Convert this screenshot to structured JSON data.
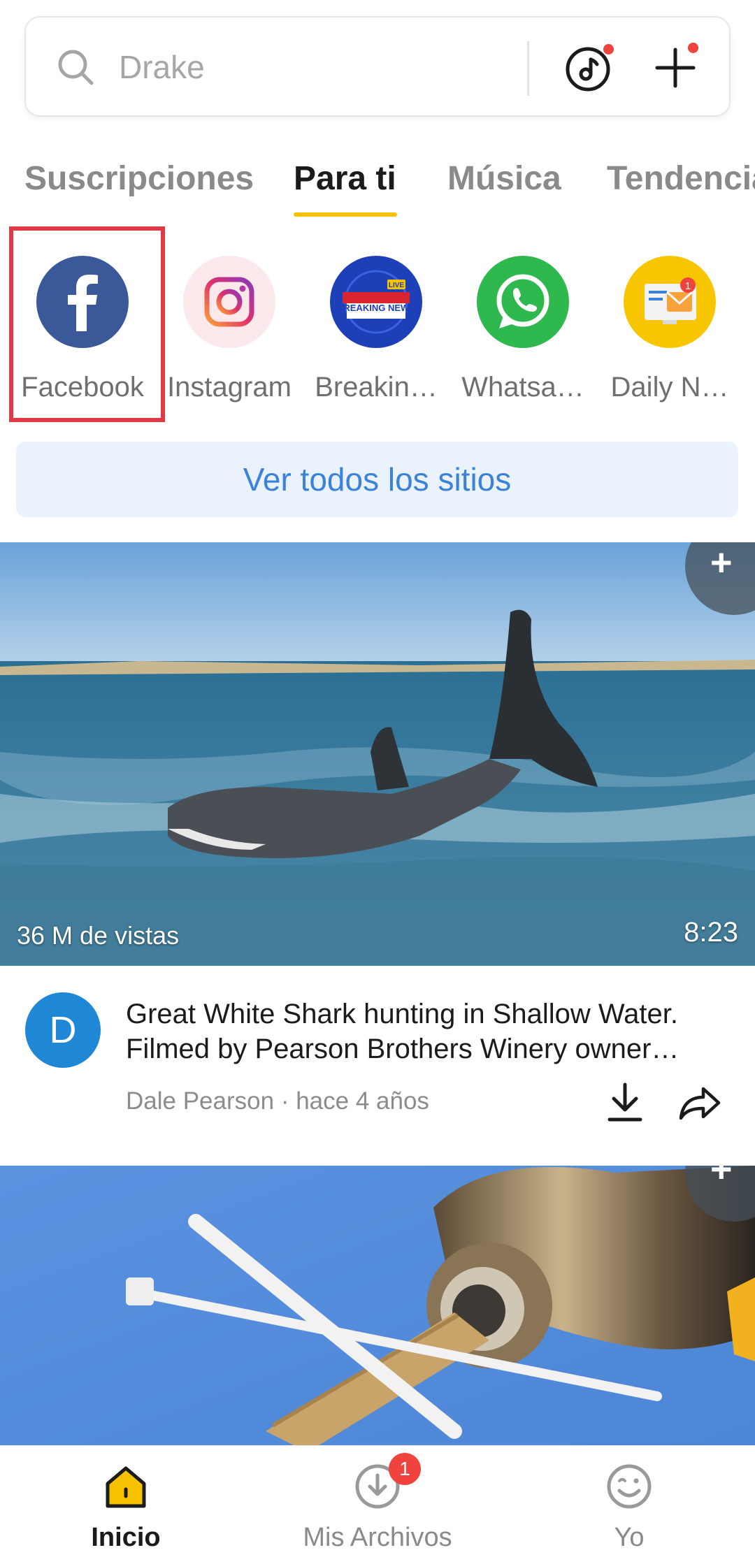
{
  "search": {
    "placeholder": "Drake"
  },
  "tabs": [
    {
      "label": "Suscripciones"
    },
    {
      "label": "Para ti",
      "active": true
    },
    {
      "label": "Música"
    },
    {
      "label": "Tendencia"
    }
  ],
  "sites": [
    {
      "label": "Facebook",
      "icon": "facebook-icon",
      "color": "#3b5998"
    },
    {
      "label": "Instagram",
      "icon": "instagram-icon",
      "color": "#fbe8ea"
    },
    {
      "label": "Breakin…",
      "icon": "breaking-news-icon",
      "color": "#1d3fb8",
      "logo_text": "BREAKING NEWS",
      "logo_badge": "LIVE"
    },
    {
      "label": "Whatsa…",
      "icon": "whatsapp-icon",
      "color": "#2fb84d"
    },
    {
      "label": "Daily N…",
      "icon": "daily-news-icon",
      "color": "#f7c600",
      "badge": "1"
    }
  ],
  "view_all_label": "Ver todos los sitios",
  "video1": {
    "views": "36 M de vistas",
    "duration": "8:23",
    "avatar_letter": "D",
    "title_line1": "Great White Shark hunting in Shallow Water.",
    "title_line2": "Filmed by Pearson Brothers Winery owner…",
    "channel": "Dale Pearson",
    "separator": "·",
    "age": "hace 4 años"
  },
  "bottom_nav": [
    {
      "label": "Inicio",
      "icon": "home-icon",
      "active": true
    },
    {
      "label": "Mis Archivos",
      "icon": "download-icon",
      "badge": "1"
    },
    {
      "label": "Yo",
      "icon": "smiley-icon"
    }
  ],
  "colors": {
    "accent_yellow": "#f6c200",
    "badge_red": "#f0433d",
    "link_blue": "#3b82d8",
    "highlight_red": "#e23a44"
  }
}
